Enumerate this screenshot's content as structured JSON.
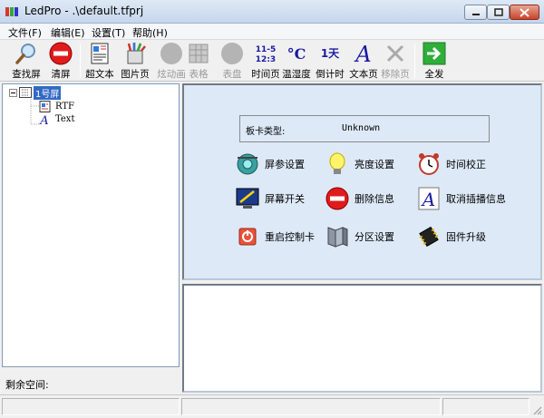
{
  "window": {
    "title": "LedPro - .\\default.tfprj"
  },
  "menu": [
    {
      "label": "文件(F)"
    },
    {
      "label": "编辑(E)"
    },
    {
      "label": "设置(T)"
    },
    {
      "label": "帮助(H)"
    }
  ],
  "toolbar": [
    {
      "label": "查找屏",
      "icon": "search-icon",
      "enabled": true
    },
    {
      "label": "清屏",
      "icon": "clear-icon",
      "enabled": true
    },
    {
      "label": "超文本",
      "icon": "hypertext-icon",
      "enabled": true
    },
    {
      "label": "图片页",
      "icon": "picture-page-icon",
      "enabled": true
    },
    {
      "label": "炫动画",
      "icon": "animation-icon",
      "enabled": false
    },
    {
      "label": "表格",
      "icon": "table-icon",
      "enabled": false
    },
    {
      "label": "表盘",
      "icon": "dial-icon",
      "enabled": false
    },
    {
      "label": "时间页",
      "icon": "time-icon",
      "enabled": true,
      "glyph": "11-5\n12:3"
    },
    {
      "label": "温湿度",
      "icon": "temperature-icon",
      "enabled": true,
      "glyph": "°C"
    },
    {
      "label": "倒计时",
      "icon": "countdown-icon",
      "enabled": true,
      "glyph": "1天"
    },
    {
      "label": "文本页",
      "icon": "text-page-icon",
      "enabled": true,
      "glyph": "A"
    },
    {
      "label": "移除页",
      "icon": "remove-icon",
      "enabled": false
    },
    {
      "label": "全发",
      "icon": "send-all-icon",
      "enabled": true
    }
  ],
  "tree": {
    "root": "1号屏",
    "children": [
      {
        "label": "RTF",
        "icon": "rtf-icon"
      },
      {
        "label": "Text",
        "icon": "text-icon"
      }
    ]
  },
  "left_status": {
    "free_space_label": "剩余空间:"
  },
  "card_type": {
    "label": "板卡类型:",
    "value": "Unknown"
  },
  "actions": [
    {
      "label": "屏参设置",
      "icon": "screen-params-icon"
    },
    {
      "label": "亮度设置",
      "icon": "brightness-icon"
    },
    {
      "label": "时间校正",
      "icon": "clock-icon"
    },
    {
      "label": "屏幕开关",
      "icon": "screen-switch-icon"
    },
    {
      "label": "删除信息",
      "icon": "delete-icon"
    },
    {
      "label": "取消插播信息",
      "icon": "cancel-insert-icon"
    },
    {
      "label": "重启控制卡",
      "icon": "restart-icon"
    },
    {
      "label": "分区设置",
      "icon": "partition-icon"
    },
    {
      "label": "固件升级",
      "icon": "firmware-icon"
    }
  ],
  "colors": {
    "accent": "#316ac5",
    "panel_bg": "#dde9f7"
  }
}
